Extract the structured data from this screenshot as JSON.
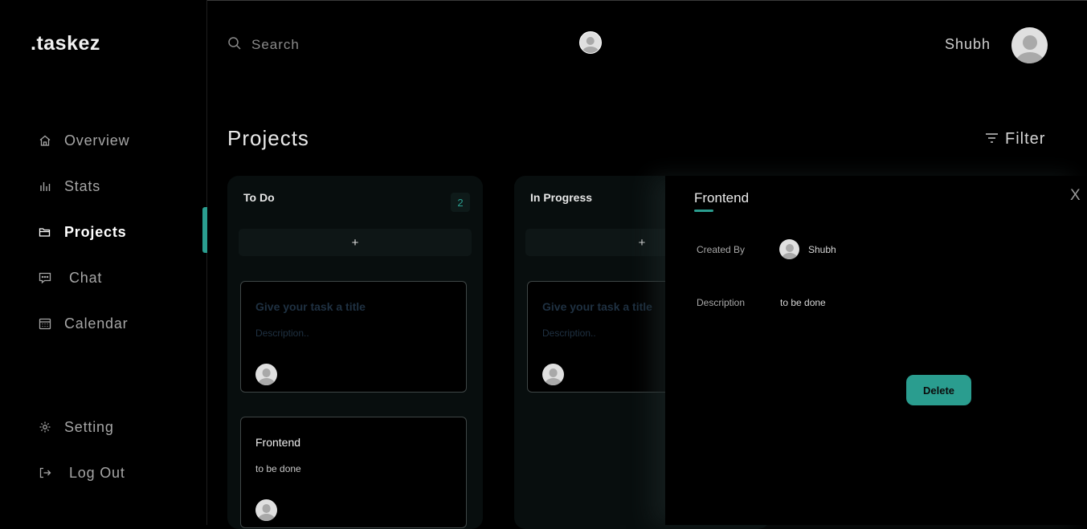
{
  "app": {
    "logo": ".taskez"
  },
  "sidebar": {
    "items": [
      {
        "label": "Overview",
        "icon": "home-icon"
      },
      {
        "label": "Stats",
        "icon": "bar-chart-icon"
      },
      {
        "label": "Projects",
        "icon": "folder-icon",
        "active": true
      },
      {
        "label": "Chat",
        "icon": "chat-icon"
      },
      {
        "label": "Calendar",
        "icon": "calendar-icon"
      }
    ],
    "bottom": [
      {
        "label": "Setting",
        "icon": "gear-icon"
      },
      {
        "label": "Log Out",
        "icon": "logout-icon"
      }
    ]
  },
  "header": {
    "search_placeholder": "Search",
    "user_name": "Shubh"
  },
  "main": {
    "title": "Projects",
    "filter_label": "Filter",
    "add_label": "+",
    "columns": [
      {
        "title": "To Do",
        "count": "2",
        "cards": [
          {
            "title": "Give your task a title",
            "description": "Description..",
            "placeholder": true
          },
          {
            "title": "Frontend",
            "description": "to be done",
            "placeholder": false
          }
        ]
      },
      {
        "title": "In Progress",
        "cards": [
          {
            "title": "Give your task a title",
            "description": "Description..",
            "placeholder": true
          }
        ]
      }
    ]
  },
  "detail": {
    "title": "Frontend",
    "close_label": "X",
    "created_by_label": "Created By",
    "created_by_value": "Shubh",
    "description_label": "Description",
    "description_value": "to be done",
    "delete_label": "Delete"
  },
  "colors": {
    "accent": "#2a9d8f",
    "background": "#000000",
    "column": "#080e0e"
  }
}
